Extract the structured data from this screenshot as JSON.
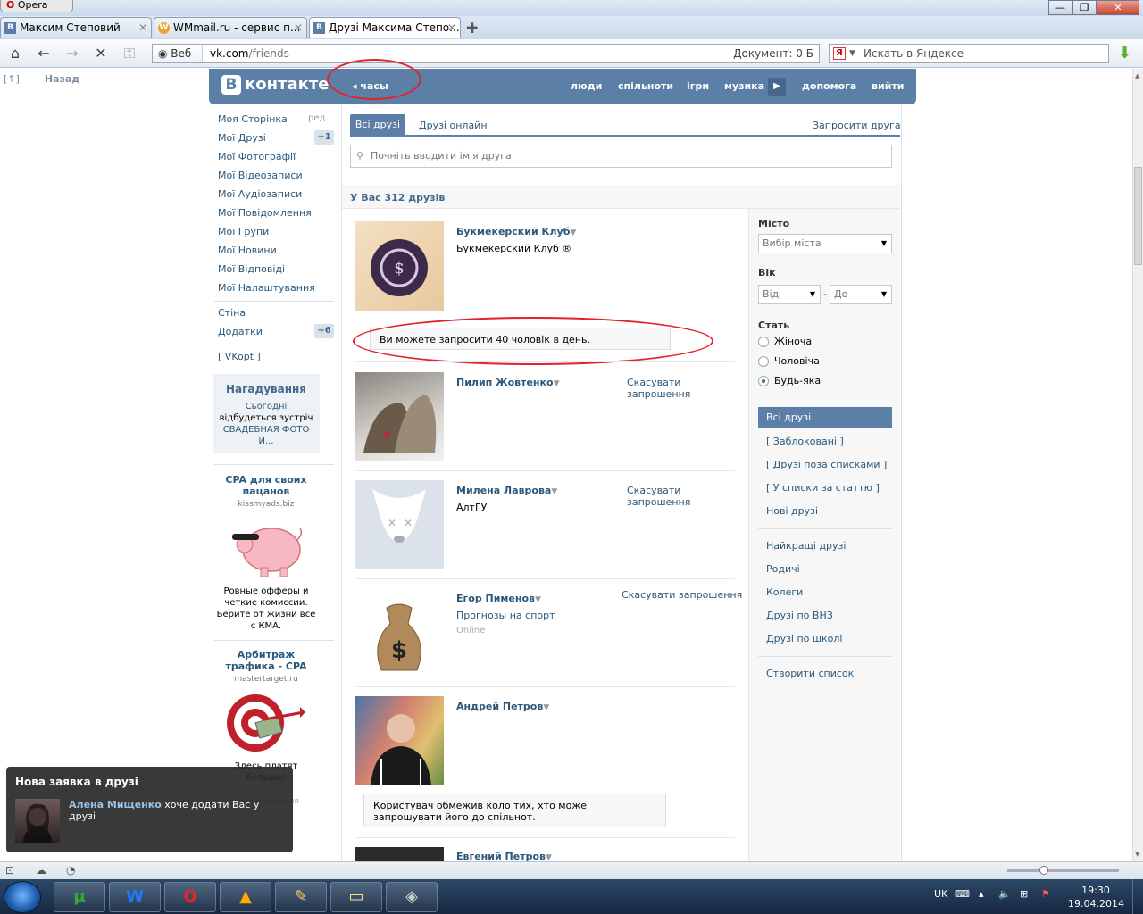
{
  "browser": {
    "app_name": "Opera",
    "tabs": [
      {
        "label": "Максим Степовий",
        "icon": "В"
      },
      {
        "label": "WMmail.ru - сервис п...",
        "icon": "W"
      },
      {
        "label": "Друзі Максима Степо...",
        "icon": "В"
      }
    ],
    "address": {
      "web_label": "Веб",
      "url_domain": "vk.com",
      "url_path": "/friends",
      "document_info": "Документ:   0 Б"
    },
    "search_placeholder": "Искать в Яндексе",
    "back_label": "Назад",
    "top_marker": "[↑]"
  },
  "vk": {
    "logo_letter": "В",
    "logo_text": "контакте",
    "clock_link": "часы",
    "topnav": [
      "люди",
      "спільноти",
      "ігри",
      "музика",
      "допомога",
      "вийти"
    ]
  },
  "left_menu": {
    "items": [
      "Моя Сторінка",
      "Мої Друзі",
      "Мої Фотографії",
      "Мої Відеозаписи",
      "Мої Аудіозаписи",
      "Мої Повідомлення",
      "Мої Групи",
      "Мої Новини",
      "Мої Відповіді",
      "Мої Налаштування"
    ],
    "edit_label": "ред.",
    "friends_badge": "+1",
    "wall": "Стіна",
    "apps": "Додатки",
    "apps_badge": "+6",
    "vkopt": "[ VKopt ]",
    "reminder": {
      "title": "Нагадування",
      "today": "Сьогодні",
      "text": "відбудеться зустріч",
      "event": "СВАДЕБНАЯ ФОТО",
      "event_more": "И..."
    },
    "ads": [
      {
        "title": "CPA для своих пацанов",
        "domain": "kissmyads.biz",
        "text": "Ровные офферы и четкие комиссии. Берите от жизни все с КМА."
      },
      {
        "title": "Арбитраж трафика - CPA",
        "domain": "mastertarget.ru",
        "text": "Здесь платят больше!"
      }
    ],
    "all_ads": "Усі оголошення"
  },
  "content": {
    "tabs": {
      "all": "Всі друзі",
      "online": "Друзі онлайн"
    },
    "invite_friend": "Запросити друга",
    "search_placeholder": "Почніть вводити ім'я друга",
    "count": "У Вас 312 друзів",
    "friends": [
      {
        "name": "Букмекерский Клуб",
        "sub": "Букмекерский Клуб ®"
      },
      {
        "name": "Пилип Жовтенко",
        "sub": ""
      },
      {
        "name": "Милена Лаврова",
        "sub": "АлтГУ"
      },
      {
        "name": "Егор Пименов",
        "sub": "Прогнозы на спорт",
        "status": "Online"
      },
      {
        "name": "Андрей Петров",
        "sub": ""
      },
      {
        "name": "Евгений Петров",
        "sub": ""
      }
    ],
    "cancel_request": "Скасувати запрошення",
    "cancel_request_line1": "Скасувати",
    "cancel_request_line2": "запрошення",
    "invite_limit_notice": "Ви можете запросити 40 чоловік в день.",
    "restricted_notice": "Користувач обмежив коло тих, хто може запрошувати його до спільнот."
  },
  "filters": {
    "city_label": "Місто",
    "city_placeholder": "Вибір міста",
    "age_label": "Вік",
    "age_from": "Від",
    "age_dash": "-",
    "age_to": "До",
    "sex_label": "Стать",
    "sex_options": [
      "Жіноча",
      "Чоловіча",
      "Будь-яка"
    ],
    "sex_selected": 2,
    "lists": {
      "all": "Всі друзі",
      "blocked": "[ Заблоковані ]",
      "outside": "[ Друзі поза списками ]",
      "by_gender": "[ У списки за статтю ]",
      "new": "Нові друзі",
      "best": "Найкращі друзі",
      "family": "Родичі",
      "colleagues": "Колеги",
      "university": "Друзі по ВНЗ",
      "school": "Друзі по школі",
      "create": "Створити список"
    }
  },
  "notification": {
    "title": "Нова заявка в друзі",
    "user": "Алена Мищенко",
    "text": " хоче додати Вас у друзі"
  },
  "taskbar": {
    "lang": "UK",
    "time": "19:30",
    "date": "19.04.2014"
  },
  "colors": {
    "vk_blue": "#5b7fa6",
    "link": "#2b587a",
    "annotation_red": "#e3222a"
  }
}
